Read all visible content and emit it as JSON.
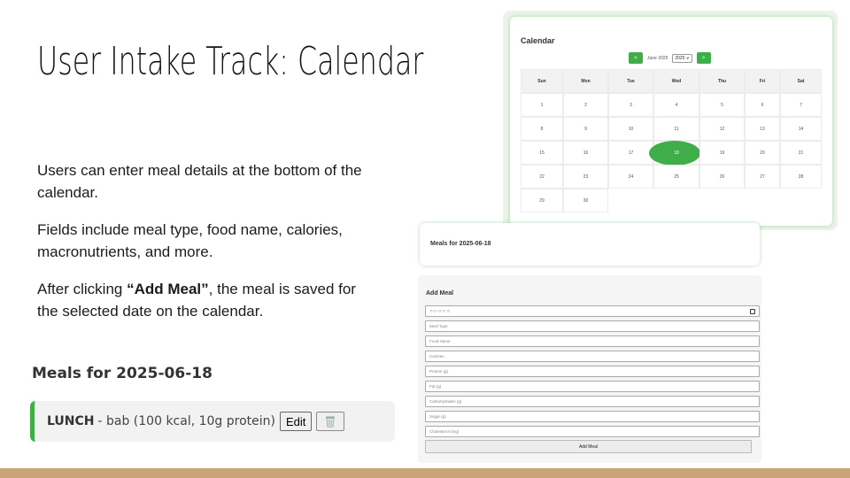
{
  "slide": {
    "title": "User Intake Track: Calendar",
    "bullets": [
      "Users can enter meal details at the bottom of the calendar.",
      "Fields include meal type, food name, calories, macronutrients, and more.",
      {
        "prefix": "After clicking ",
        "bold": "“Add Meal”",
        "suffix": ", the meal is saved for the selected date on the calendar."
      }
    ]
  },
  "meals_panel": {
    "heading": "Meals for 2025-06-18",
    "item": {
      "meal_type": "LUNCH",
      "details": "- bab (100 kcal, 10g protein)",
      "edit_label": "Edit",
      "delete_icon": "trash-icon"
    }
  },
  "calendar": {
    "title": "Calendar",
    "prev_label": "<",
    "next_label": ">",
    "month_label": "June 2025",
    "year_value": "2025 ∨",
    "weekdays": [
      "Sun",
      "Mon",
      "Tue",
      "Wed",
      "Thu",
      "Fri",
      "Sat"
    ],
    "days": [
      "1",
      "2",
      "3",
      "4",
      "5",
      "6",
      "7",
      "8",
      "9",
      "10",
      "11",
      "12",
      "13",
      "14",
      "15",
      "16",
      "17",
      "18",
      "19",
      "20",
      "21",
      "22",
      "23",
      "24",
      "25",
      "26",
      "27",
      "28",
      "29",
      "30"
    ],
    "selected_day": "18",
    "accent_color": "#3fae49"
  },
  "meals_card": {
    "label": "Meals for 2025-06-18"
  },
  "add_meal": {
    "title": "Add Meal",
    "date_placeholder": "ㅇㅇ-ㅇㅇ-ㅇ",
    "fields": [
      "Meal Type",
      "Food Name",
      "Calories",
      "Protein (g)",
      "Fat (g)",
      "Carbohydrates (g)",
      "Sugar (g)",
      "Cholesterol (mg)"
    ],
    "button_label": "Add Meal"
  }
}
